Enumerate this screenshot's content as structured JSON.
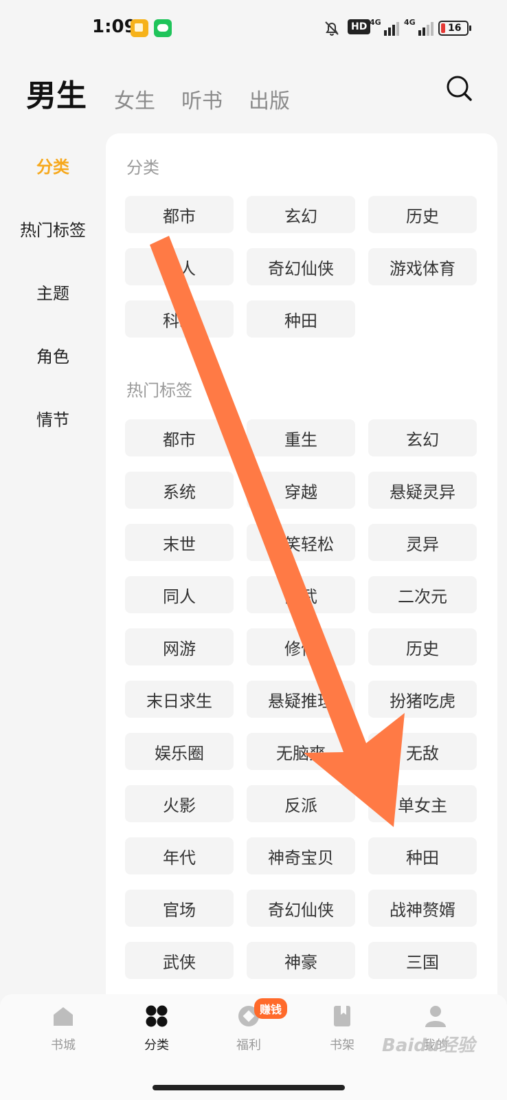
{
  "status_bar": {
    "time": "1:09",
    "hd": "HD",
    "net1": "4G",
    "net2": "4G",
    "battery": "16"
  },
  "top_tabs": [
    "男生",
    "女生",
    "听书",
    "出版"
  ],
  "sidebar": {
    "items": [
      "分类",
      "热门标签",
      "主题",
      "角色",
      "情节"
    ]
  },
  "sections": {
    "category": {
      "title": "分类",
      "items": [
        "都市",
        "玄幻",
        "历史",
        "同人",
        "奇幻仙侠",
        "游戏体育",
        "科幻",
        "种田"
      ]
    },
    "hot_tags": {
      "title": "热门标签",
      "items": [
        "都市",
        "重生",
        "玄幻",
        "系统",
        "穿越",
        "悬疑灵异",
        "末世",
        "搞笑轻松",
        "灵异",
        "同人",
        "高武",
        "二次元",
        "网游",
        "修仙",
        "历史",
        "末日求生",
        "悬疑推理",
        "扮猪吃虎",
        "娱乐圈",
        "无脑爽",
        "无敌",
        "火影",
        "反派",
        "单女主",
        "年代",
        "神奇宝贝",
        "种田",
        "官场",
        "奇幻仙侠",
        "战神赘婿",
        "武侠",
        "神豪",
        "三国"
      ]
    }
  },
  "bottom_nav": {
    "items": [
      "书城",
      "分类",
      "福利",
      "书架",
      "我的"
    ],
    "earn_badge": "赚钱"
  },
  "watermark": "Baidu经验",
  "colors": {
    "accent": "#f6a81c",
    "arrow": "#ff7a45",
    "badge": "#ff6a2a"
  }
}
